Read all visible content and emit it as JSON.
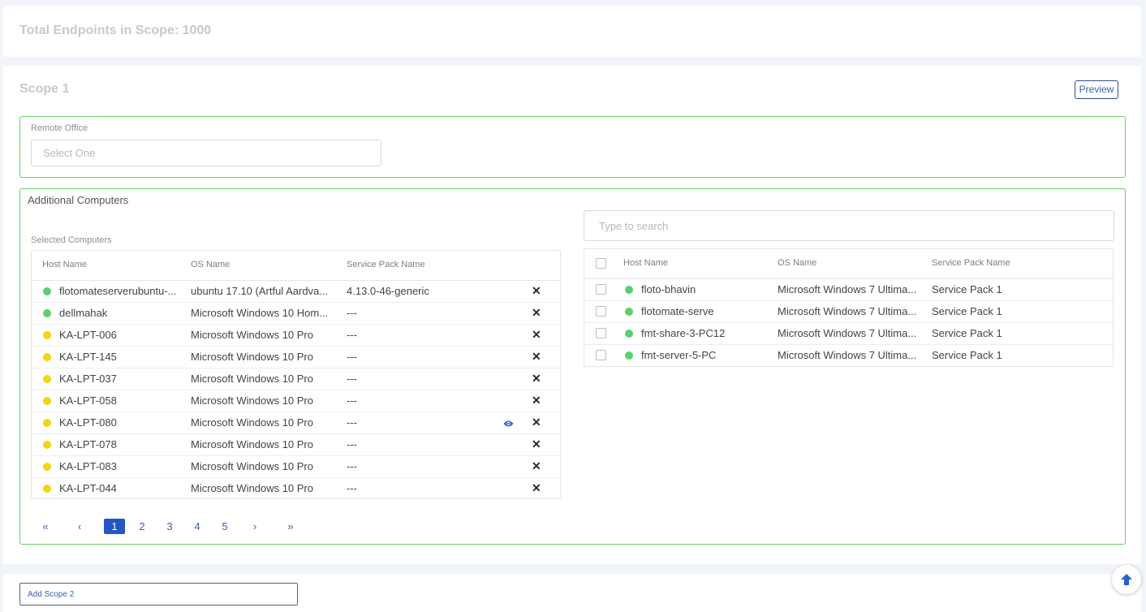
{
  "summary": {
    "total_label": "Total Endpoints in Scope: 1000"
  },
  "scope": {
    "title": "Scope 1",
    "preview_label": "Preview",
    "remote_office": {
      "label": "Remote Office",
      "placeholder": "Select One"
    },
    "additional": {
      "title": "Additional Computers",
      "selected_label": "Selected Computers",
      "search_placeholder": "Type to search",
      "columns": {
        "host": "Host Name",
        "os": "OS Name",
        "sp": "Service Pack Name"
      },
      "selected_rows": [
        {
          "host": "flotomateserverubuntu-...",
          "os": "ubuntu 17.10 (Artful Aardva...",
          "sp": "4.13.0-46-generic",
          "status": "#5cd06c"
        },
        {
          "host": "dellmahak",
          "os": "Microsoft Windows 10 Hom...",
          "sp": "---",
          "status": "#5cd06c"
        },
        {
          "host": "KA-LPT-006",
          "os": "Microsoft Windows 10 Pro",
          "sp": "---",
          "status": "#f5d410"
        },
        {
          "host": "KA-LPT-145",
          "os": "Microsoft Windows 10 Pro",
          "sp": "---",
          "status": "#f5d410"
        },
        {
          "host": "KA-LPT-037",
          "os": "Microsoft Windows 10 Pro",
          "sp": "---",
          "status": "#f5d410"
        },
        {
          "host": "KA-LPT-058",
          "os": "Microsoft Windows 10 Pro",
          "sp": "---",
          "status": "#f5d410"
        },
        {
          "host": "KA-LPT-080",
          "os": "Microsoft Windows 10 Pro",
          "sp": "---",
          "status": "#f5d410"
        },
        {
          "host": "KA-LPT-078",
          "os": "Microsoft Windows 10 Pro",
          "sp": "---",
          "status": "#f5d410"
        },
        {
          "host": "KA-LPT-083",
          "os": "Microsoft Windows 10 Pro",
          "sp": "---",
          "status": "#f5d410"
        },
        {
          "host": "KA-LPT-044",
          "os": "Microsoft Windows 10 Pro",
          "sp": "---",
          "status": "#f5d410"
        }
      ],
      "available_rows": [
        {
          "host": "floto-bhavin",
          "os": "Microsoft Windows 7 Ultima...",
          "sp": "Service Pack 1",
          "status": "#5cd06c"
        },
        {
          "host": "flotomate-serve",
          "os": "Microsoft Windows 7 Ultima...",
          "sp": "Service Pack 1",
          "status": "#5cd06c"
        },
        {
          "host": "fmt-share-3-PC12",
          "os": "Microsoft Windows 7 Ultima...",
          "sp": "Service Pack 1",
          "status": "#5cd06c"
        },
        {
          "host": "fmt-server-5-PC",
          "os": "Microsoft Windows 7 Ultima...",
          "sp": "Service Pack 1",
          "status": "#5cd06c"
        }
      ],
      "pagination": {
        "first": "«",
        "prev": "‹",
        "pages": [
          "1",
          "2",
          "3",
          "4",
          "5"
        ],
        "current": "1",
        "next": "›",
        "last": "»"
      }
    }
  },
  "add_scope_label": "Add Scope 2",
  "icons": {
    "remove": "close-icon",
    "view": "eye-icon",
    "scroll_top": "arrow-up-icon"
  },
  "colors": {
    "accent": "#2456c4",
    "online": "#5cd06c",
    "warning": "#f5d410",
    "border_ok": "#6cce6c"
  }
}
